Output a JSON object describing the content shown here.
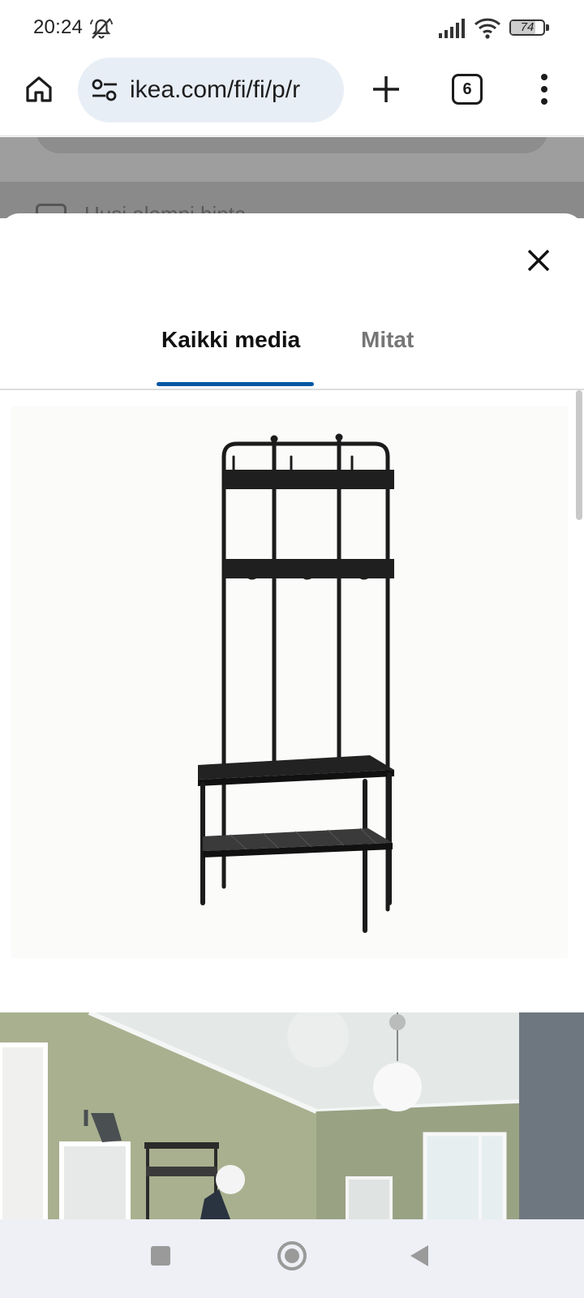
{
  "status_bar": {
    "time": "20:24",
    "battery_level": "74",
    "battery_fraction": 0.74,
    "icons": [
      "mute-icon",
      "signal-icon",
      "wifi-icon",
      "battery-icon"
    ]
  },
  "browser": {
    "url": "ikea.com/fi/fi/p/r",
    "tab_count": "6",
    "icons": [
      "home-icon",
      "site-settings-icon",
      "plus-icon",
      "more-vert-icon"
    ]
  },
  "page_behind": {
    "partial_text": "Uusi alempi hinta"
  },
  "modal": {
    "tabs": [
      {
        "label": "Kaikki media",
        "active": true
      },
      {
        "label": "Mitat",
        "active": false
      }
    ],
    "icons": [
      "close-icon"
    ]
  },
  "media": [
    {
      "kind": "product-image",
      "subject": "coat-rack-with-shoe-storage-bench"
    },
    {
      "kind": "room-photo",
      "subject": "hallway-with-coat-rack"
    }
  ],
  "colors": {
    "accent": "#0058a3",
    "url_pill": "#e8eef6",
    "nav_bar": "#eef0f6",
    "dim_overlay": "#9e9e9e"
  },
  "nav": {
    "icons": [
      "recents-icon",
      "home-circle-icon",
      "back-icon"
    ]
  }
}
